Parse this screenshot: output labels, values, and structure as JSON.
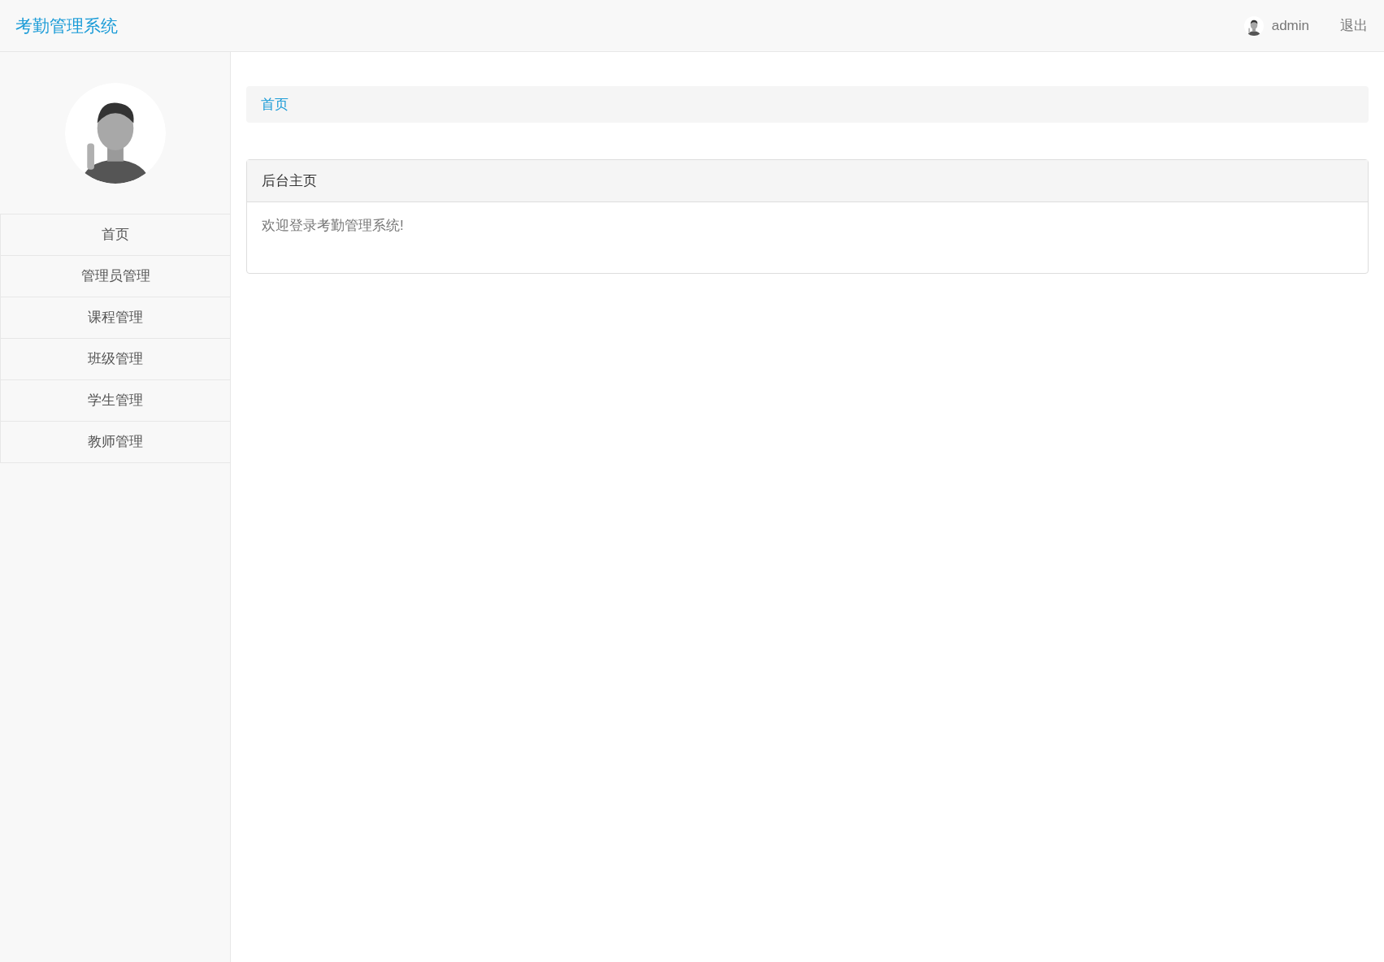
{
  "navbar": {
    "brand": "考勤管理系统",
    "user": "admin",
    "logout": "退出"
  },
  "sidebar": {
    "items": [
      {
        "label": "首页",
        "selected": false
      },
      {
        "label": "管理员管理",
        "selected": false
      },
      {
        "label": "课程管理",
        "selected": false
      },
      {
        "label": "班级管理",
        "selected": false
      },
      {
        "label": "学生管理",
        "selected": false
      },
      {
        "label": "教师管理",
        "selected": false
      }
    ]
  },
  "breadcrumb": [
    "首页"
  ],
  "panel": {
    "title": "后台主页",
    "body": "欢迎登录考勤管理系统!"
  }
}
